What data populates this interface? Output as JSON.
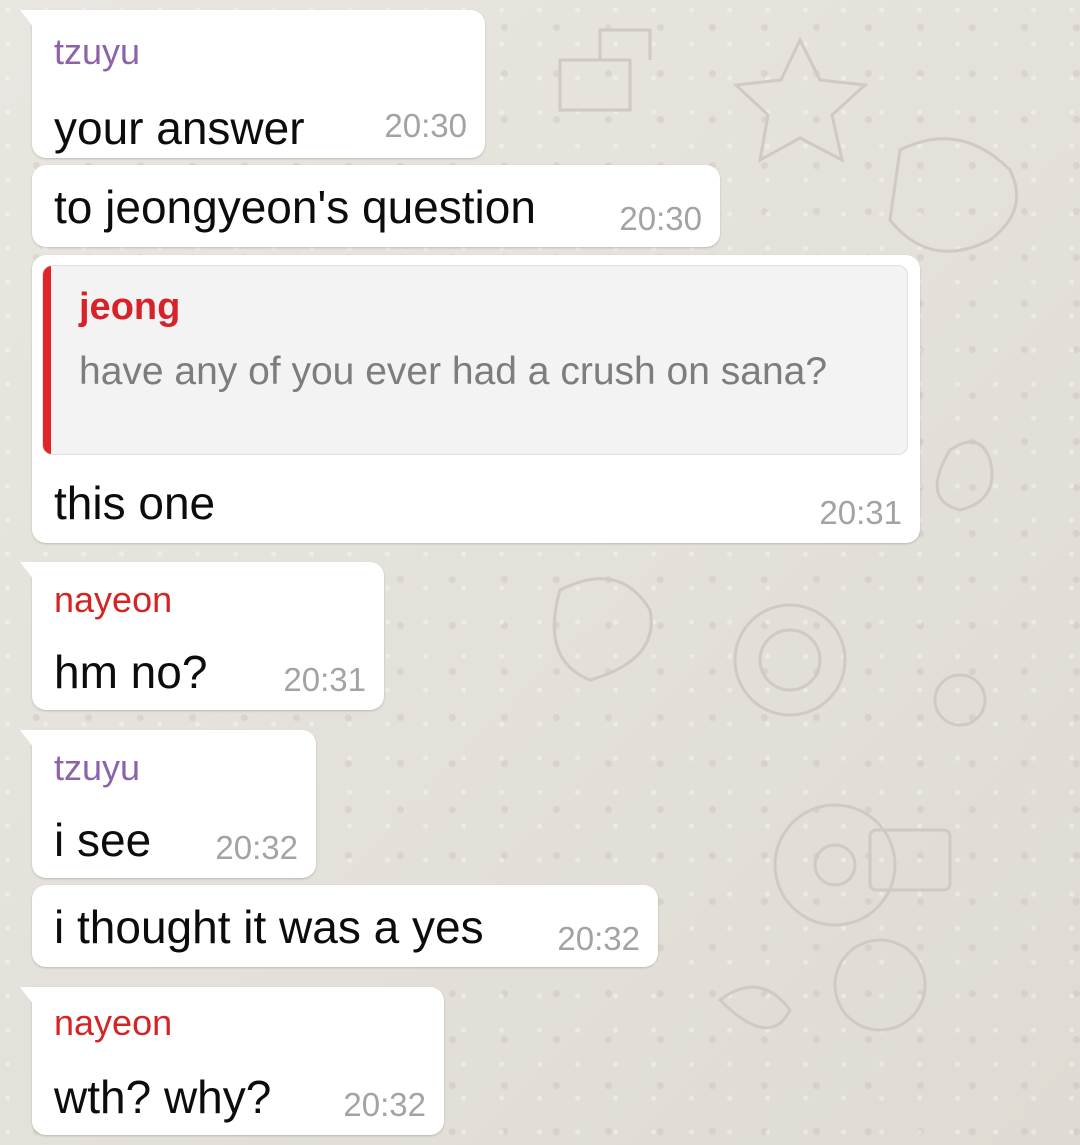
{
  "theme": {
    "bubble_bg": "#ffffff",
    "chat_bg": "#e6e3dd",
    "time_color": "#a3a3a3",
    "sender_colors": {
      "tzuyu": "#8c63a8",
      "nayeon": "#d42424",
      "jeong": "#d82229"
    },
    "quote_bar_color": "#e0242a"
  },
  "messages": [
    {
      "sender": "tzuyu",
      "text": "your answer",
      "time": "20:30"
    },
    {
      "text": "to jeongyeon's question",
      "time": "20:30"
    },
    {
      "reply_to": {
        "sender": "jeong",
        "text": "have any of you ever had a crush on sana?"
      },
      "text": "this one",
      "time": "20:31"
    },
    {
      "sender": "nayeon",
      "text": "hm no?",
      "time": "20:31"
    },
    {
      "sender": "tzuyu",
      "text": "i see",
      "time": "20:32"
    },
    {
      "text": "i thought it was a yes",
      "time": "20:32"
    },
    {
      "sender": "nayeon",
      "text": "wth? why?",
      "time": "20:32"
    }
  ]
}
